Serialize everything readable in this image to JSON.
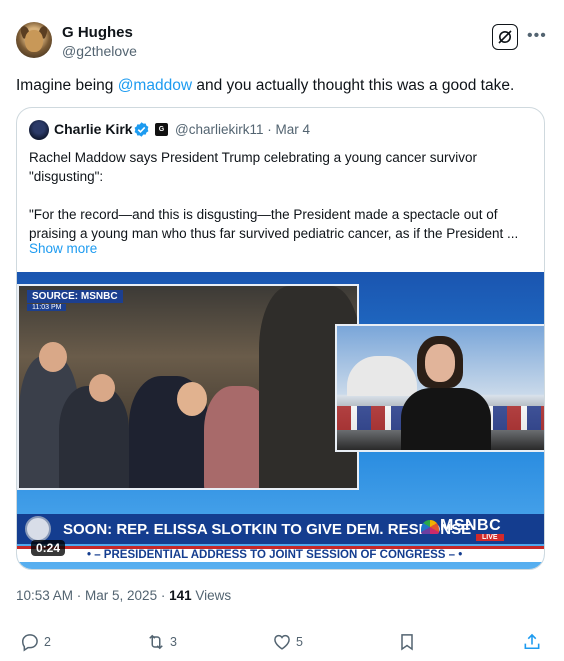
{
  "post": {
    "author": {
      "display_name": "G Hughes",
      "handle": "@g2thelove"
    },
    "text_before": "Imagine being ",
    "mention": "@maddow",
    "text_after": " and you actually thought this was a good take.",
    "timestamp": "10:53 AM · Mar 5, 2025 · ",
    "views_count": "141",
    "views_label": " Views",
    "icons": {
      "grok": "grok-icon",
      "more": "more-dots-icon"
    }
  },
  "quote": {
    "author": {
      "display_name": "Charlie Kirk",
      "handle_date": "@charliekirk11 · Mar 4",
      "badge": "G"
    },
    "lines": [
      "Rachel Maddow says President Trump celebrating a young cancer survivor",
      "\"disgusting\":",
      "",
      "\"For the record—and this is disgusting—the President made a spectacle out of",
      "praising a young man who thus far survived pediatric cancer, as if the President ..."
    ],
    "show_more": "Show more",
    "video": {
      "source_label": "SOURCE: MSNBC",
      "source_time": "11:03 PM",
      "banner": "SOON: REP. ELISSA SLOTKIN TO GIVE DEM. RESPONSE",
      "network": "MSNBC",
      "live": "LIVE",
      "ticker": "• – PRESIDENTIAL ADDRESS TO JOINT SESSION OF CONGRESS – •",
      "duration": "0:24"
    }
  },
  "actions": {
    "reply": {
      "icon": "reply-icon",
      "count": "2"
    },
    "repost": {
      "icon": "repost-icon",
      "count": "3"
    },
    "like": {
      "icon": "heart-icon",
      "count": "5"
    },
    "bookmark": {
      "icon": "bookmark-icon"
    },
    "share": {
      "icon": "share-icon"
    }
  },
  "colors": {
    "link": "#1d9bf0",
    "muted": "#536471",
    "text": "#0f1419",
    "border": "#cfd9de"
  }
}
